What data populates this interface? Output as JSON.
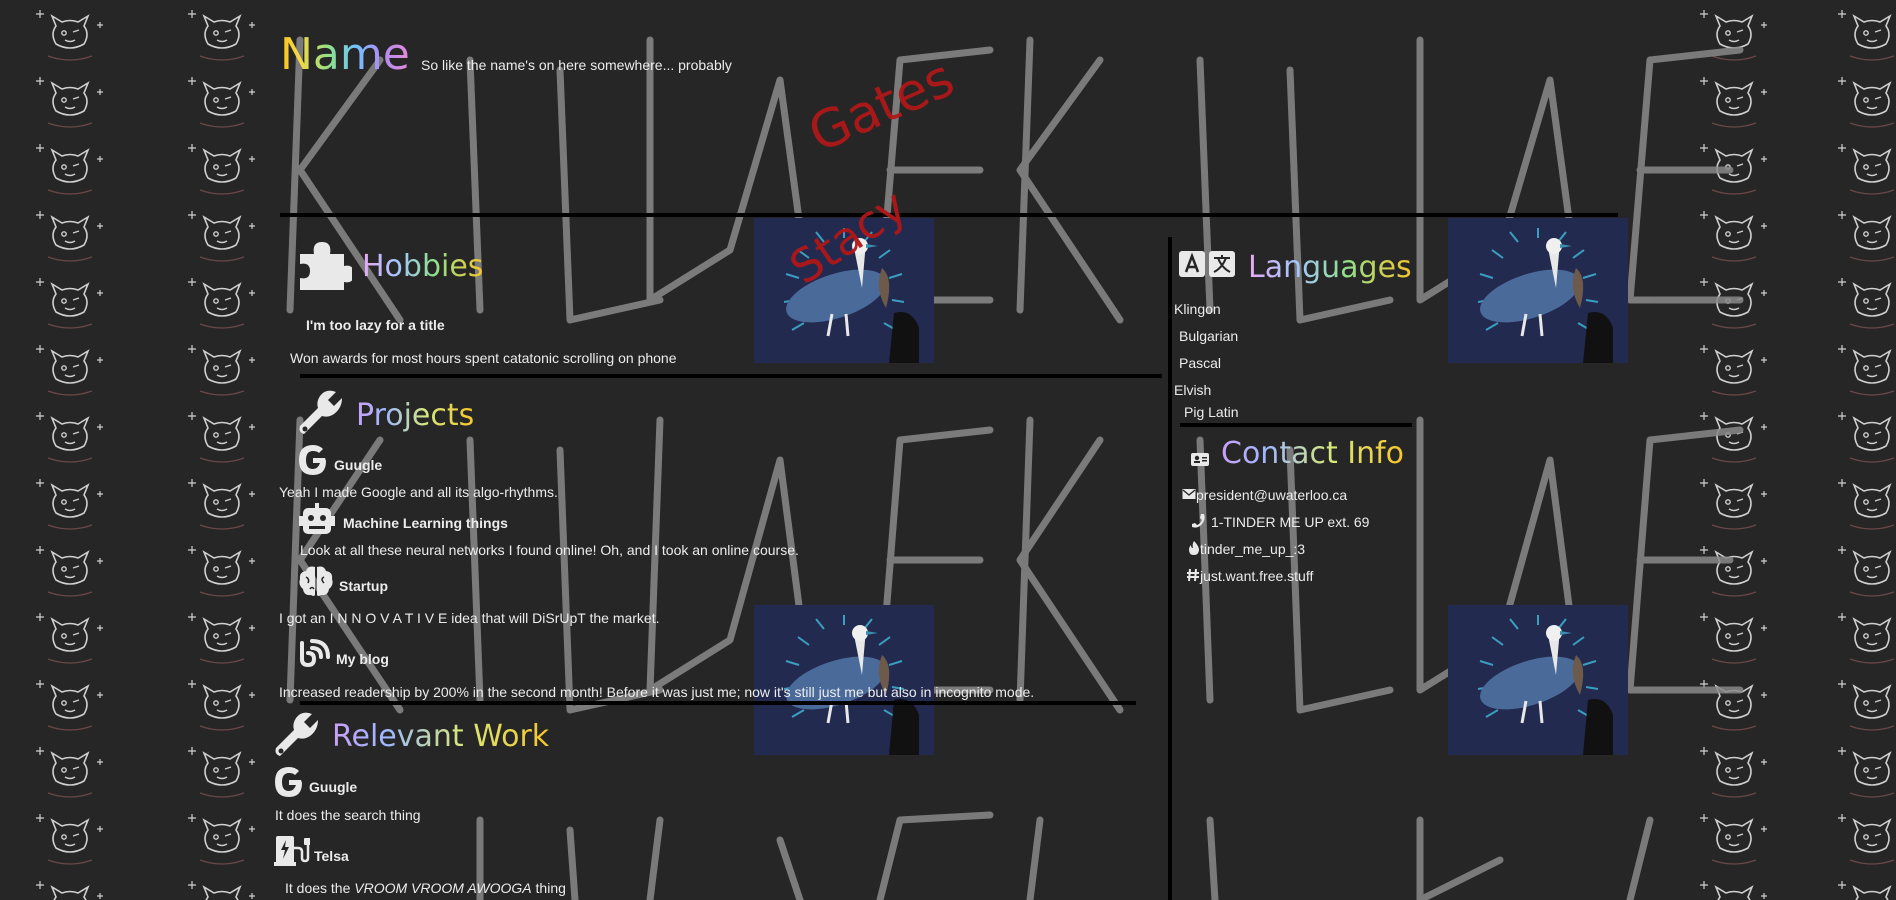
{
  "header": {
    "name": "Name",
    "subtitle": "So like the name's on here somewhere... probably",
    "stamp_gates": "Gates",
    "stamp_stacy": "Stacy"
  },
  "hobbies": {
    "title": "Hobbies",
    "items": [
      {
        "heading": "I'm too lazy for a title",
        "desc": "Won awards for most hours spent catatonic scrolling on phone"
      }
    ]
  },
  "projects": {
    "title": "Projects",
    "items": [
      {
        "icon": "google-icon",
        "heading": "Guugle",
        "desc": "Yeah I made Google and all its algo-rhythms."
      },
      {
        "icon": "robot-icon",
        "heading": "Machine Learning things",
        "desc": "Look at all these neural networks I found online! Oh, and I took an online course."
      },
      {
        "icon": "brain-icon",
        "heading": "Startup",
        "desc": "I got an I N N O V A T I V E idea that will DiSrUpT the market."
      },
      {
        "icon": "blog-icon",
        "heading": "My blog",
        "desc": "Increased readership by 200% in the second month! Before it was just me; now it's still just me but also in incognito mode."
      }
    ]
  },
  "work": {
    "title": "Relevant Work",
    "items": [
      {
        "icon": "google-icon",
        "heading": "Guugle",
        "desc": "It does the search thing"
      },
      {
        "icon": "charging-station-icon",
        "heading": "Telsa",
        "desc_pre": "It does the ",
        "desc_em": "VROOM VROOM AWOOGA",
        "desc_post": "  thing"
      }
    ]
  },
  "languages": {
    "title": "Languages",
    "items": [
      "Klingon",
      "Bulgarian",
      "Pascal",
      "Elvish",
      "Pig Latin"
    ]
  },
  "contact": {
    "title": "Contact Info",
    "email": "president@uwaterloo.ca",
    "phone": "1-TINDER ME UP ext. 69",
    "tinder": "tinder_me_up_:3",
    "hashtag": "just.want.free.stuff"
  },
  "colors": {
    "background": "#262626",
    "stamp_red": "#b01818",
    "goose_bg": "#232a4f"
  }
}
